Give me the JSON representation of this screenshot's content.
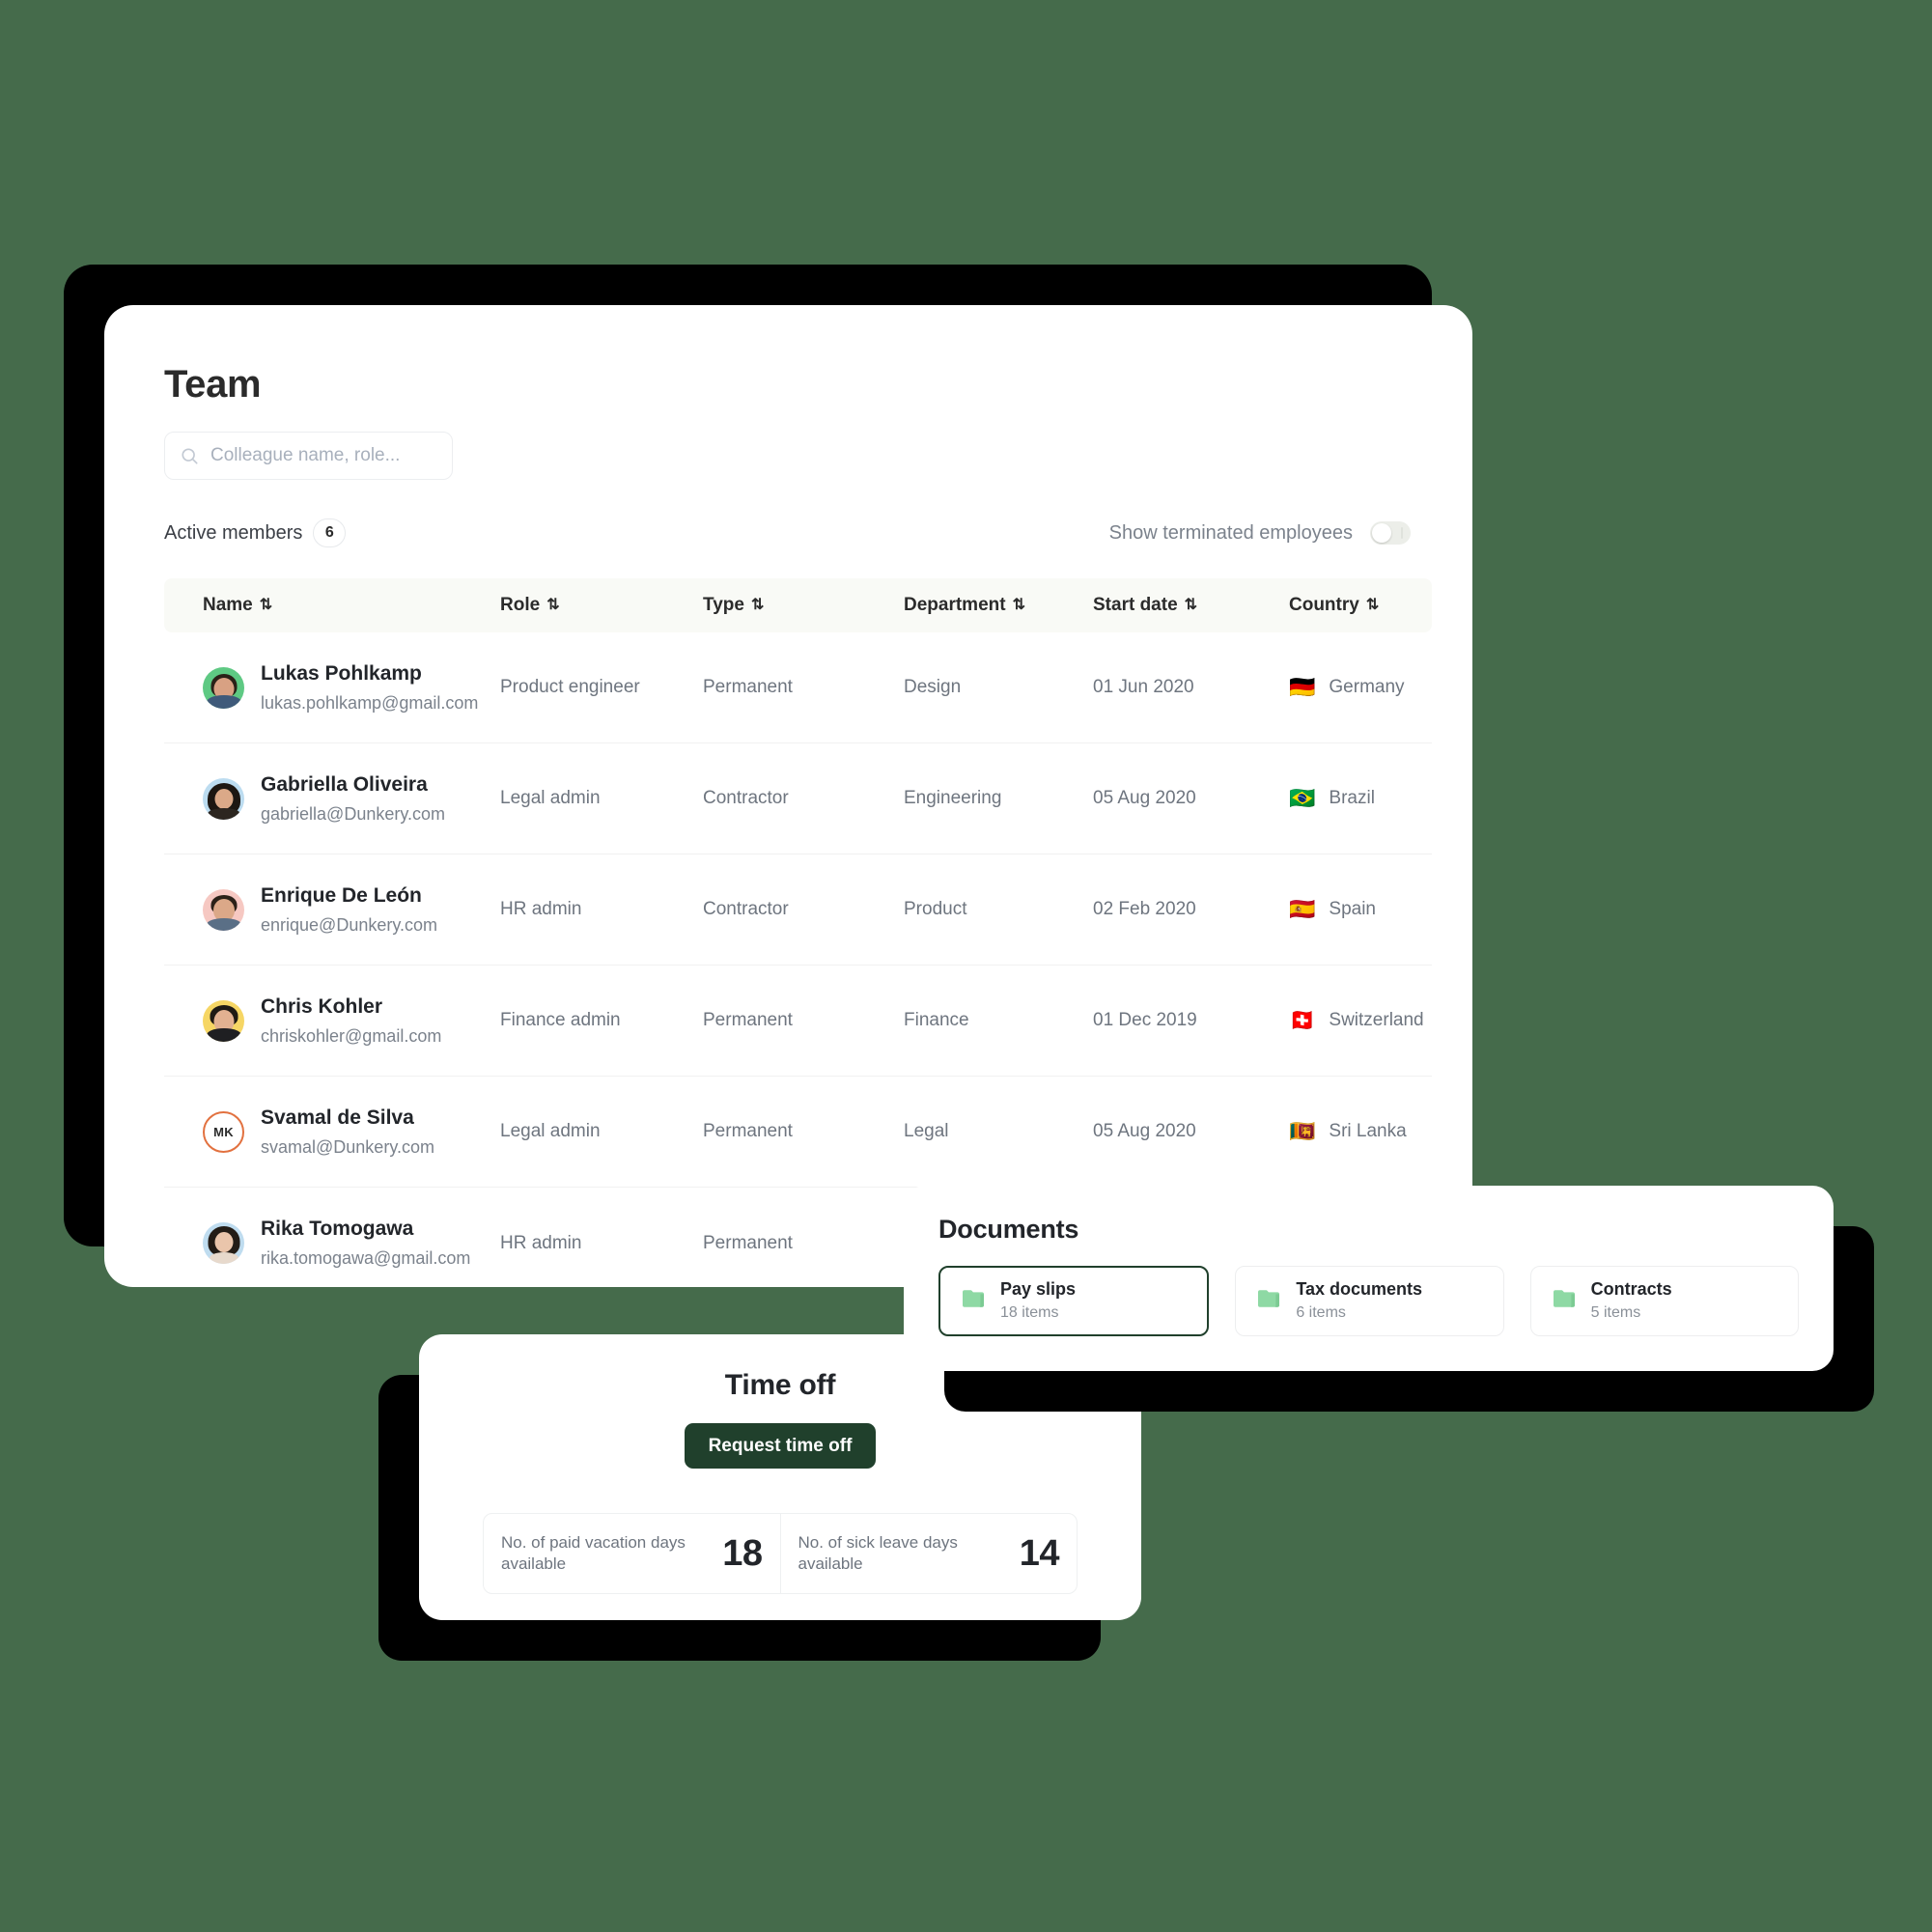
{
  "background_color": "#456b4b",
  "team": {
    "title": "Team",
    "search": {
      "placeholder": "Colleague name, role...",
      "value": "",
      "icon": "search-icon"
    },
    "active_members_label": "Active members",
    "active_members_count": "6",
    "terminated_toggle": {
      "label": "Show terminated employees",
      "state": "off"
    },
    "columns": [
      {
        "key": "name",
        "label": "Name",
        "sortable": true
      },
      {
        "key": "role",
        "label": "Role",
        "sortable": true
      },
      {
        "key": "type",
        "label": "Type",
        "sortable": true
      },
      {
        "key": "department",
        "label": "Department",
        "sortable": true
      },
      {
        "key": "start_date",
        "label": "Start date",
        "sortable": true
      },
      {
        "key": "country",
        "label": "Country",
        "sortable": true
      }
    ],
    "rows": [
      {
        "name": "Lukas Pohlkamp",
        "email": "lukas.pohlkamp@gmail.com",
        "role": "Product engineer",
        "type": "Permanent",
        "department": "Design",
        "start_date": "01 Jun 2020",
        "country": "Germany",
        "flag": "🇩🇪",
        "avatar": {
          "kind": "photo",
          "bg": "#5ec983",
          "hair": "#2a2118",
          "skin": "#d8a183",
          "shirt": "#3f5a7a"
        }
      },
      {
        "name": "Gabriella Oliveira",
        "email": "gabriella@Dunkery.com",
        "role": "Legal admin",
        "type": "Contractor",
        "department": "Engineering",
        "start_date": "05 Aug 2020",
        "country": "Brazil",
        "flag": "🇧🇷",
        "avatar": {
          "kind": "photo",
          "bg": "#bcdcf0",
          "hair": "#1d1712",
          "skin": "#dba988",
          "shirt": "#2c2620"
        }
      },
      {
        "name": "Enrique De León",
        "email": "enrique@Dunkery.com",
        "role": "HR admin",
        "type": "Contractor",
        "department": "Product",
        "start_date": "02 Feb 2020",
        "country": "Spain",
        "flag": "🇪🇸",
        "avatar": {
          "kind": "photo",
          "bg": "#f6c8c2",
          "hair": "#2b2118",
          "skin": "#dba888",
          "shirt": "#5a6f86"
        }
      },
      {
        "name": "Chris Kohler",
        "email": "chriskohler@gmail.com",
        "role": "Finance admin",
        "type": "Permanent",
        "department": "Finance",
        "start_date": "01 Dec 2019",
        "country": "Switzerland",
        "flag": "🇨🇭",
        "avatar": {
          "kind": "photo",
          "bg": "#f6d664",
          "hair": "#1f1a14",
          "skin": "#e2b191",
          "shirt": "#1f1f22"
        }
      },
      {
        "name": "Svamal de Silva",
        "email": "svamal@Dunkery.com",
        "role": "Legal admin",
        "type": "Permanent",
        "department": "Legal",
        "start_date": "05 Aug 2020",
        "country": "Sri Lanka",
        "flag": "🇱🇰",
        "avatar": {
          "kind": "initials",
          "initials": "MK",
          "ring": "#e2713f"
        }
      },
      {
        "name": "Rika Tomogawa",
        "email": "rika.tomogawa@gmail.com",
        "role": "HR admin",
        "type": "Permanent",
        "department": "",
        "start_date": "",
        "country": "",
        "flag": "",
        "avatar": {
          "kind": "photo",
          "bg": "#bfdcef",
          "hair": "#231c16",
          "skin": "#eac5ab",
          "shirt": "#e7d9cc"
        }
      }
    ]
  },
  "documents": {
    "title": "Documents",
    "folders": [
      {
        "name": "Pay slips",
        "count": "18 items",
        "selected": true
      },
      {
        "name": "Tax documents",
        "count": "6 items",
        "selected": false
      },
      {
        "name": "Contracts",
        "count": "5 items",
        "selected": false
      }
    ],
    "folder_icon_color": "#8ed9a4",
    "selected_border_color": "#20402c"
  },
  "time_off": {
    "title": "Time off",
    "request_button": "Request time off",
    "button_color": "#20402c",
    "stats": [
      {
        "label": "No. of paid vacation days available",
        "value": "18"
      },
      {
        "label": "No. of sick leave days available",
        "value": "14"
      }
    ]
  }
}
